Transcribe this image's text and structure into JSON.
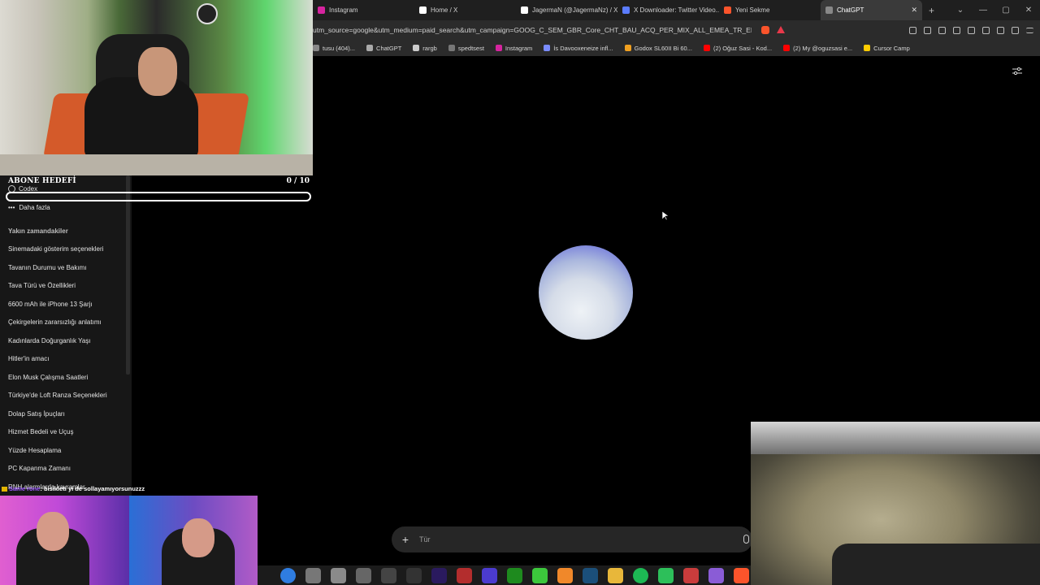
{
  "browser": {
    "tabs": [
      {
        "label": "Instagram",
        "icon": "instagram-icon",
        "color": "#d6249f"
      },
      {
        "label": "Home / X",
        "icon": "x-icon",
        "color": "#ffffff"
      },
      {
        "label": "JagermaN (@JagermaNz) / X",
        "icon": "x-icon",
        "color": "#ffffff"
      },
      {
        "label": "X Downloader: Twitter Video...",
        "icon": "downloader-icon",
        "color": "#5b7cff"
      },
      {
        "label": "Yeni Sekme",
        "icon": "brave-icon",
        "color": "#fb542b"
      },
      {
        "label": "ChatGPT",
        "icon": "chatgpt-icon",
        "color": "#888888",
        "active": true
      }
    ],
    "url": "utm_source=google&utm_medium=paid_search&utm_campaign=GOOG_C_SEM_GBR_Core_CHT_BAU_ACQ_PER_MIX_ALL_EMEA_TR_EN_03...",
    "bookmarks": [
      {
        "label": "tusu (404)...",
        "color": "#888888"
      },
      {
        "label": "ChatGPT",
        "color": "#aaaaaa"
      },
      {
        "label": "rargb",
        "color": "#cccccc"
      },
      {
        "label": "spedtsest",
        "color": "#777777"
      },
      {
        "label": "Instagram",
        "color": "#d6249f"
      },
      {
        "label": "İs Davooxeneize infl...",
        "color": "#7a8cff"
      },
      {
        "label": "Godox SL60II Bi 60...",
        "color": "#f0a020"
      },
      {
        "label": "(2) Oğuz Sasi - Kod...",
        "color": "#ff0000"
      },
      {
        "label": "(2) My @oguzsasi e...",
        "color": "#ff0000"
      },
      {
        "label": "Cursor Camp",
        "color": "#ffcc00"
      }
    ]
  },
  "goal": {
    "title": "ABONE HEDEFİ",
    "count": "0 / 10",
    "progress": 0
  },
  "sidebar": {
    "codex": "Codex",
    "more": "Daha fazla",
    "recent_title": "Yakın zamandakiler",
    "recent": [
      "Sinemadaki gösterim seçenekleri",
      "Tavanın Durumu ve Bakımı",
      "Tava Türü ve Özellikleri",
      "6600 mAh ile iPhone 13 Şarjı",
      "Çekirgelerin zararsızlığı anlatımı",
      "Kadınlarda Doğurganlık Yaşı",
      "Hitler'in amacı",
      "Elon Musk Çalışma Saatleri",
      "Türkiye'de Loft Ranza Seçenekleri",
      "Dolap Satış İpuçları",
      "Hizmet Bedeli ve Uçuş",
      "Yüzde Hesaplama",
      "PC Kapanma Zamanı",
      "RNH alarmlarda kavramlar"
    ]
  },
  "composer": {
    "placeholder": "Tür"
  },
  "chat_overlay": {
    "user": "Same rone",
    "message": ": bisikleti yi de sollayamıyorsunuzzz"
  },
  "taskbar": {
    "icons": [
      {
        "name": "windows-icon",
        "color": "#2f7de1"
      },
      {
        "name": "app-icon-1",
        "color": "#777777"
      },
      {
        "name": "app-icon-2",
        "color": "#8a8a8a"
      },
      {
        "name": "app-icon-3",
        "color": "#666666"
      },
      {
        "name": "clapper-icon",
        "color": "#444444"
      },
      {
        "name": "epic-icon",
        "color": "#333333"
      },
      {
        "name": "premiere-icon",
        "color": "#2a1a5e"
      },
      {
        "name": "app-icon-4",
        "color": "#b32d2d"
      },
      {
        "name": "app-icon-5",
        "color": "#4b3bcf"
      },
      {
        "name": "xbox-icon",
        "color": "#1e8a1e"
      },
      {
        "name": "razer-icon",
        "color": "#3cc73c"
      },
      {
        "name": "cloud-icon",
        "color": "#f0882a"
      },
      {
        "name": "steam-icon",
        "color": "#1b4f7a"
      },
      {
        "name": "folder-icon",
        "color": "#e8b73a"
      },
      {
        "name": "spotify-icon",
        "color": "#1db954"
      },
      {
        "name": "app-icon-6",
        "color": "#2dbf5a"
      },
      {
        "name": "app-icon-7",
        "color": "#c93c3c"
      },
      {
        "name": "app-icon-8",
        "color": "#8a5cd6"
      },
      {
        "name": "brave-icon",
        "color": "#fb542b"
      }
    ]
  }
}
